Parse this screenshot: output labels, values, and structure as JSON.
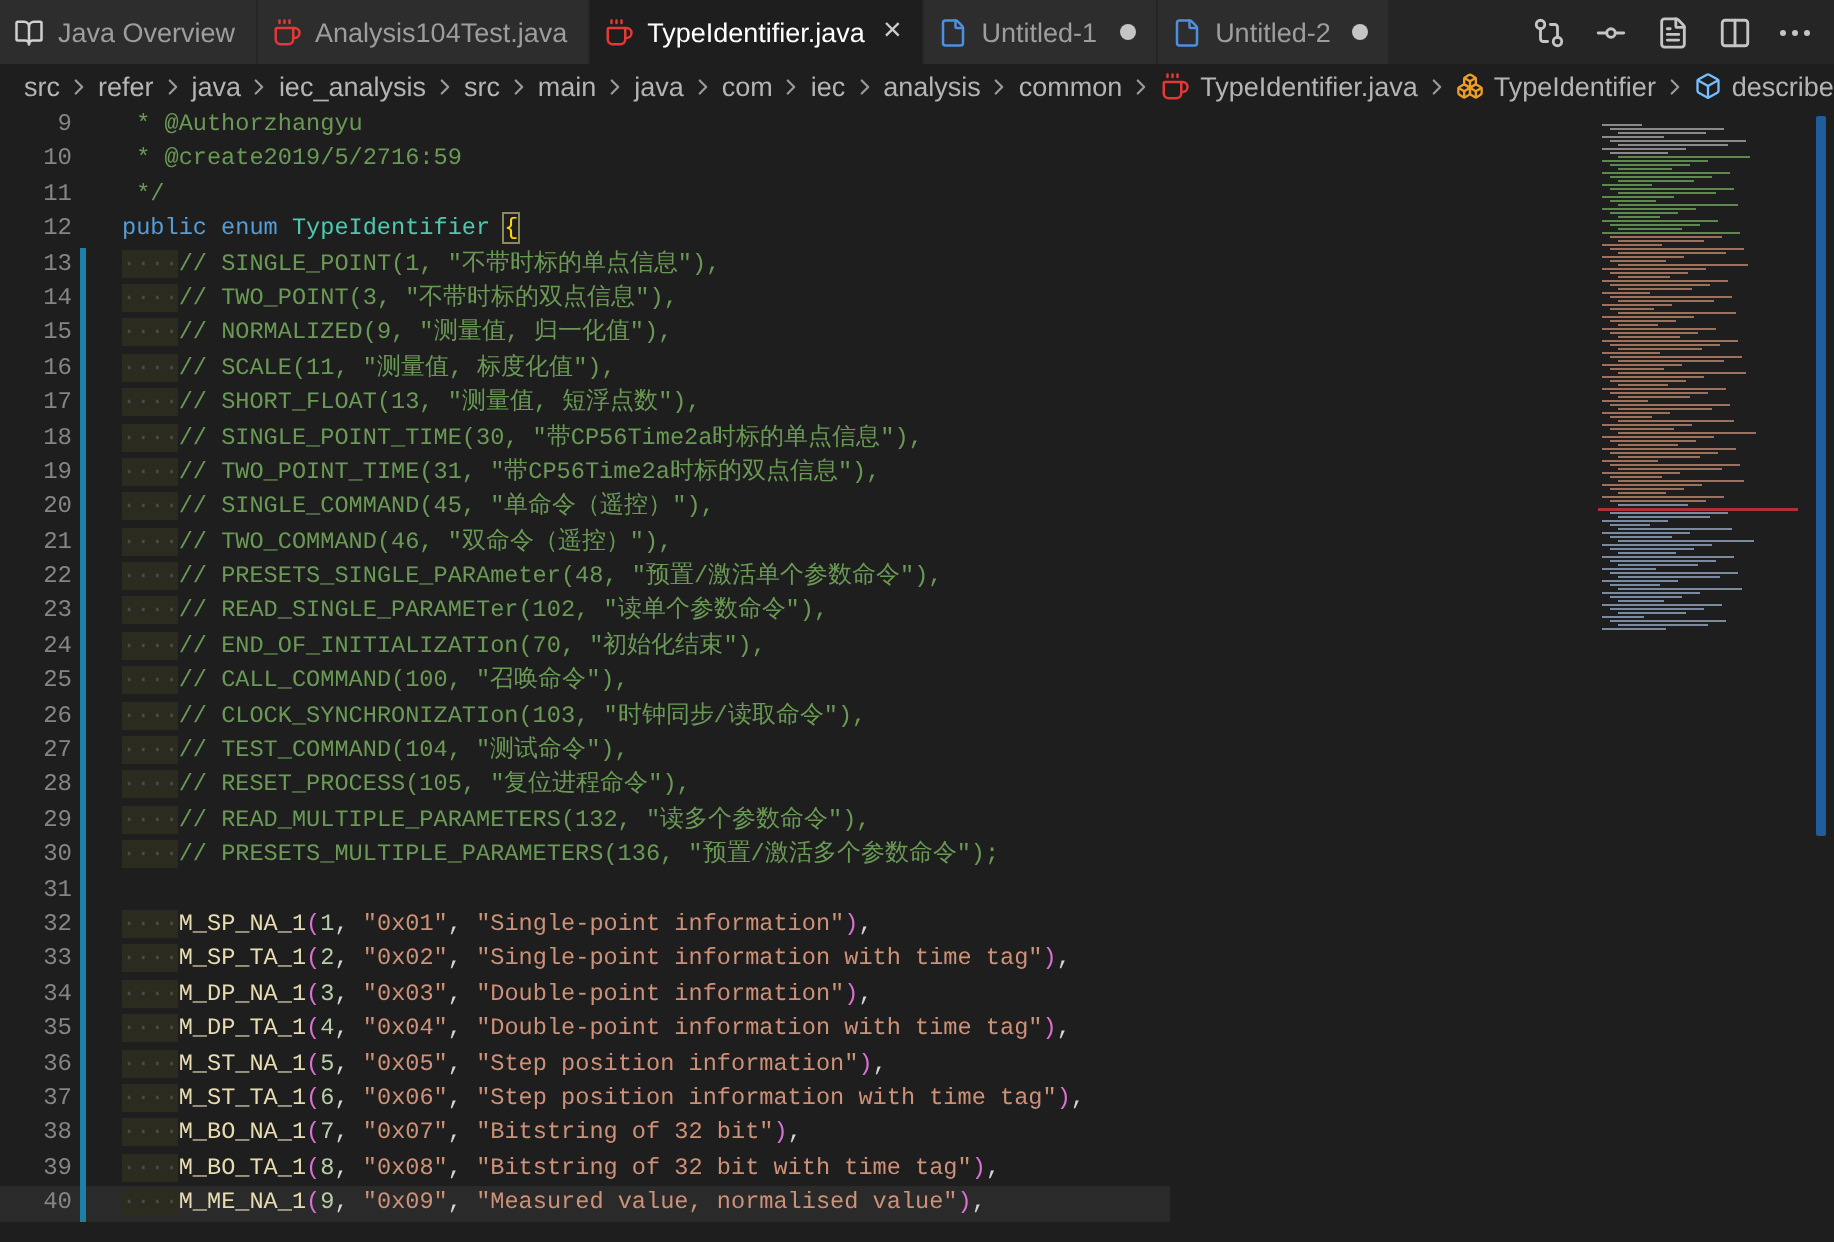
{
  "tabs": [
    {
      "label": "Java Overview",
      "kind": "overview",
      "selected": false,
      "dirty": false
    },
    {
      "label": "Analysis104Test.java",
      "kind": "source",
      "selected": false,
      "dirty": false
    },
    {
      "label": "TypeIdentifier.java",
      "kind": "source",
      "selected": true,
      "dirty": false,
      "close": "×"
    },
    {
      "label": "Untitled-1",
      "kind": "untitled",
      "selected": false,
      "dirty": true
    },
    {
      "label": "Untitled-2",
      "kind": "untitled",
      "selected": false,
      "dirty": true
    }
  ],
  "toolbar": [
    {
      "kind": "compare"
    },
    {
      "kind": "git"
    },
    {
      "kind": "preview"
    },
    {
      "kind": "split"
    },
    {
      "kind": "more"
    }
  ],
  "breadcrumb": [
    {
      "label": "src",
      "kind": "folder"
    },
    {
      "label": "refer",
      "kind": "folder"
    },
    {
      "label": "java",
      "kind": "folder"
    },
    {
      "label": "iec_analysis",
      "kind": "folder"
    },
    {
      "label": "src",
      "kind": "folder"
    },
    {
      "label": "main",
      "kind": "folder"
    },
    {
      "label": "java",
      "kind": "folder"
    },
    {
      "label": "com",
      "kind": "folder"
    },
    {
      "label": "iec",
      "kind": "folder"
    },
    {
      "label": "analysis",
      "kind": "folder"
    },
    {
      "label": "common",
      "kind": "folder"
    },
    {
      "label": "TypeIdentifier.java",
      "kind": "source"
    },
    {
      "label": "TypeIdentifier",
      "kind": "enum"
    },
    {
      "label": "describe",
      "kind": "member"
    }
  ],
  "lines": [
    {
      "number": "9",
      "modified": false,
      "current": false,
      "tokens": [
        {
          "kind": "comment",
          "text": " * @Authorzhangyu"
        }
      ]
    },
    {
      "number": "10",
      "modified": false,
      "current": false,
      "tokens": [
        {
          "kind": "comment",
          "text": " * @create2019/5/2716:59"
        }
      ]
    },
    {
      "number": "11",
      "modified": false,
      "current": false,
      "tokens": [
        {
          "kind": "comment",
          "text": " */"
        }
      ]
    },
    {
      "number": "12",
      "modified": false,
      "current": false,
      "tokens": [
        {
          "kind": "keyword",
          "text": "public enum "
        },
        {
          "kind": "type",
          "text": "TypeIdentifier "
        },
        {
          "kind": "brace",
          "text": "{"
        }
      ]
    },
    {
      "number": "13",
      "indent": "····",
      "modified": true,
      "current": false,
      "tokens": [
        {
          "kind": "comment",
          "text": "// SINGLE_POINT(1, \"不带时标的单点信息\"),"
        }
      ]
    },
    {
      "number": "14",
      "indent": "····",
      "modified": true,
      "current": false,
      "tokens": [
        {
          "kind": "comment",
          "text": "// TWO_POINT(3, \"不带时标的双点信息\"),"
        }
      ]
    },
    {
      "number": "15",
      "indent": "····",
      "modified": true,
      "current": false,
      "tokens": [
        {
          "kind": "comment",
          "text": "// NORMALIZED(9, \"测量值, 归一化值\"),"
        }
      ]
    },
    {
      "number": "16",
      "indent": "····",
      "modified": true,
      "current": false,
      "tokens": [
        {
          "kind": "comment",
          "text": "// SCALE(11, \"测量值, 标度化值\"),"
        }
      ]
    },
    {
      "number": "17",
      "indent": "····",
      "modified": true,
      "current": false,
      "tokens": [
        {
          "kind": "comment",
          "text": "// SHORT_FLOAT(13, \"测量值, 短浮点数\"),"
        }
      ]
    },
    {
      "number": "18",
      "indent": "····",
      "modified": true,
      "current": false,
      "tokens": [
        {
          "kind": "comment",
          "text": "// SINGLE_POINT_TIME(30, \"带CP56Time2a时标的单点信息\"),"
        }
      ]
    },
    {
      "number": "19",
      "indent": "····",
      "modified": true,
      "current": false,
      "tokens": [
        {
          "kind": "comment",
          "text": "// TWO_POINT_TIME(31, \"带CP56Time2a时标的双点信息\"),"
        }
      ]
    },
    {
      "number": "20",
      "indent": "····",
      "modified": true,
      "current": false,
      "tokens": [
        {
          "kind": "comment",
          "text": "// SINGLE_COMMAND(45, \"单命令（遥控）\"),"
        }
      ]
    },
    {
      "number": "21",
      "indent": "····",
      "modified": true,
      "current": false,
      "tokens": [
        {
          "kind": "comment",
          "text": "// TWO_COMMAND(46, \"双命令（遥控）\"),"
        }
      ]
    },
    {
      "number": "22",
      "indent": "····",
      "modified": true,
      "current": false,
      "tokens": [
        {
          "kind": "comment",
          "text": "// PRESETS_SINGLE_PARAmeter(48, \"预置/激活单个参数命令\"),"
        }
      ]
    },
    {
      "number": "23",
      "indent": "····",
      "modified": true,
      "current": false,
      "tokens": [
        {
          "kind": "comment",
          "text": "// READ_SINGLE_PARAMETer(102, \"读单个参数命令\"),"
        }
      ]
    },
    {
      "number": "24",
      "indent": "····",
      "modified": true,
      "current": false,
      "tokens": [
        {
          "kind": "comment",
          "text": "// END_OF_INITIALIZATIon(70, \"初始化结束\"),"
        }
      ]
    },
    {
      "number": "25",
      "indent": "····",
      "modified": true,
      "current": false,
      "tokens": [
        {
          "kind": "comment",
          "text": "// CALL_COMMAND(100, \"召唤命令\"),"
        }
      ]
    },
    {
      "number": "26",
      "indent": "····",
      "modified": true,
      "current": false,
      "tokens": [
        {
          "kind": "comment",
          "text": "// CLOCK_SYNCHRONIZATIon(103, \"时钟同步/读取命令\"),"
        }
      ]
    },
    {
      "number": "27",
      "indent": "····",
      "modified": true,
      "current": false,
      "tokens": [
        {
          "kind": "comment",
          "text": "// TEST_COMMAND(104, \"测试命令\"),"
        }
      ]
    },
    {
      "number": "28",
      "indent": "····",
      "modified": true,
      "current": false,
      "tokens": [
        {
          "kind": "comment",
          "text": "// RESET_PROCESS(105, \"复位进程命令\"),"
        }
      ]
    },
    {
      "number": "29",
      "indent": "····",
      "modified": true,
      "current": false,
      "tokens": [
        {
          "kind": "comment",
          "text": "// READ_MULTIPLE_PARAMETERS(132, \"读多个参数命令\"),"
        }
      ]
    },
    {
      "number": "30",
      "indent": "····",
      "modified": true,
      "current": false,
      "tokens": [
        {
          "kind": "comment",
          "text": "// PRESETS_MULTIPLE_PARAMETERS(136, \"预置/激活多个参数命令\");"
        }
      ]
    },
    {
      "number": "31",
      "modified": true,
      "current": false
    },
    {
      "number": "32",
      "indent": "····",
      "modified": true,
      "current": false,
      "tokens": [
        {
          "kind": "ident",
          "text": "M_SP_NA_1"
        },
        {
          "kind": "paren",
          "text": "("
        },
        {
          "kind": "number",
          "text": "1"
        },
        {
          "kind": "punct",
          "text": ", "
        },
        {
          "kind": "string",
          "text": "\"0x01\""
        },
        {
          "kind": "punct",
          "text": ", "
        },
        {
          "kind": "string",
          "text": "\"Single-point information\""
        },
        {
          "kind": "paren",
          "text": ")"
        },
        {
          "kind": "punct",
          "text": ","
        }
      ]
    },
    {
      "number": "33",
      "indent": "····",
      "modified": true,
      "current": false,
      "tokens": [
        {
          "kind": "ident",
          "text": "M_SP_TA_1"
        },
        {
          "kind": "paren",
          "text": "("
        },
        {
          "kind": "number",
          "text": "2"
        },
        {
          "kind": "punct",
          "text": ", "
        },
        {
          "kind": "string",
          "text": "\"0x02\""
        },
        {
          "kind": "punct",
          "text": ", "
        },
        {
          "kind": "string",
          "text": "\"Single-point information with time tag\""
        },
        {
          "kind": "paren",
          "text": ")"
        },
        {
          "kind": "punct",
          "text": ","
        }
      ]
    },
    {
      "number": "34",
      "indent": "····",
      "modified": true,
      "current": false,
      "tokens": [
        {
          "kind": "ident",
          "text": "M_DP_NA_1"
        },
        {
          "kind": "paren",
          "text": "("
        },
        {
          "kind": "number",
          "text": "3"
        },
        {
          "kind": "punct",
          "text": ", "
        },
        {
          "kind": "string",
          "text": "\"0x03\""
        },
        {
          "kind": "punct",
          "text": ", "
        },
        {
          "kind": "string",
          "text": "\"Double-point information\""
        },
        {
          "kind": "paren",
          "text": ")"
        },
        {
          "kind": "punct",
          "text": ","
        }
      ]
    },
    {
      "number": "35",
      "indent": "····",
      "modified": true,
      "current": false,
      "tokens": [
        {
          "kind": "ident",
          "text": "M_DP_TA_1"
        },
        {
          "kind": "paren",
          "text": "("
        },
        {
          "kind": "number",
          "text": "4"
        },
        {
          "kind": "punct",
          "text": ", "
        },
        {
          "kind": "string",
          "text": "\"0x04\""
        },
        {
          "kind": "punct",
          "text": ", "
        },
        {
          "kind": "string",
          "text": "\"Double-point information with time tag\""
        },
        {
          "kind": "paren",
          "text": ")"
        },
        {
          "kind": "punct",
          "text": ","
        }
      ]
    },
    {
      "number": "36",
      "indent": "····",
      "modified": true,
      "current": false,
      "tokens": [
        {
          "kind": "ident",
          "text": "M_ST_NA_1"
        },
        {
          "kind": "paren",
          "text": "("
        },
        {
          "kind": "number",
          "text": "5"
        },
        {
          "kind": "punct",
          "text": ", "
        },
        {
          "kind": "string",
          "text": "\"0x05\""
        },
        {
          "kind": "punct",
          "text": ", "
        },
        {
          "kind": "string",
          "text": "\"Step position information\""
        },
        {
          "kind": "paren",
          "text": ")"
        },
        {
          "kind": "punct",
          "text": ","
        }
      ]
    },
    {
      "number": "37",
      "indent": "····",
      "modified": true,
      "current": false,
      "tokens": [
        {
          "kind": "ident",
          "text": "M_ST_TA_1"
        },
        {
          "kind": "paren",
          "text": "("
        },
        {
          "kind": "number",
          "text": "6"
        },
        {
          "kind": "punct",
          "text": ", "
        },
        {
          "kind": "string",
          "text": "\"0x06\""
        },
        {
          "kind": "punct",
          "text": ", "
        },
        {
          "kind": "string",
          "text": "\"Step position information with time tag\""
        },
        {
          "kind": "paren",
          "text": ")"
        },
        {
          "kind": "punct",
          "text": ","
        }
      ]
    },
    {
      "number": "38",
      "indent": "····",
      "modified": true,
      "current": false,
      "tokens": [
        {
          "kind": "ident",
          "text": "M_BO_NA_1"
        },
        {
          "kind": "paren",
          "text": "("
        },
        {
          "kind": "number",
          "text": "7"
        },
        {
          "kind": "punct",
          "text": ", "
        },
        {
          "kind": "string",
          "text": "\"0x07\""
        },
        {
          "kind": "punct",
          "text": ", "
        },
        {
          "kind": "string",
          "text": "\"Bitstring of 32 bit\""
        },
        {
          "kind": "paren",
          "text": ")"
        },
        {
          "kind": "punct",
          "text": ","
        }
      ]
    },
    {
      "number": "39",
      "indent": "····",
      "modified": true,
      "current": false,
      "tokens": [
        {
          "kind": "ident",
          "text": "M_BO_TA_1"
        },
        {
          "kind": "paren",
          "text": "("
        },
        {
          "kind": "number",
          "text": "8"
        },
        {
          "kind": "punct",
          "text": ", "
        },
        {
          "kind": "string",
          "text": "\"0x08\""
        },
        {
          "kind": "punct",
          "text": ", "
        },
        {
          "kind": "string",
          "text": "\"Bitstring of 32 bit with time tag\""
        },
        {
          "kind": "paren",
          "text": ")"
        },
        {
          "kind": "punct",
          "text": ","
        }
      ]
    },
    {
      "number": "40",
      "indent": "····",
      "modified": true,
      "current": true,
      "tokens": [
        {
          "kind": "ident",
          "text": "M_ME_NA_1"
        },
        {
          "kind": "paren",
          "text": "("
        },
        {
          "kind": "number",
          "text": "9"
        },
        {
          "kind": "punct",
          "text": ", "
        },
        {
          "kind": "string",
          "text": "\"0x09\""
        },
        {
          "kind": "punct",
          "text": ", "
        },
        {
          "kind": "string",
          "text": "\"Measured value, normalised value\""
        },
        {
          "kind": "paren",
          "text": ")"
        },
        {
          "kind": "punct",
          "text": ","
        }
      ]
    }
  ]
}
